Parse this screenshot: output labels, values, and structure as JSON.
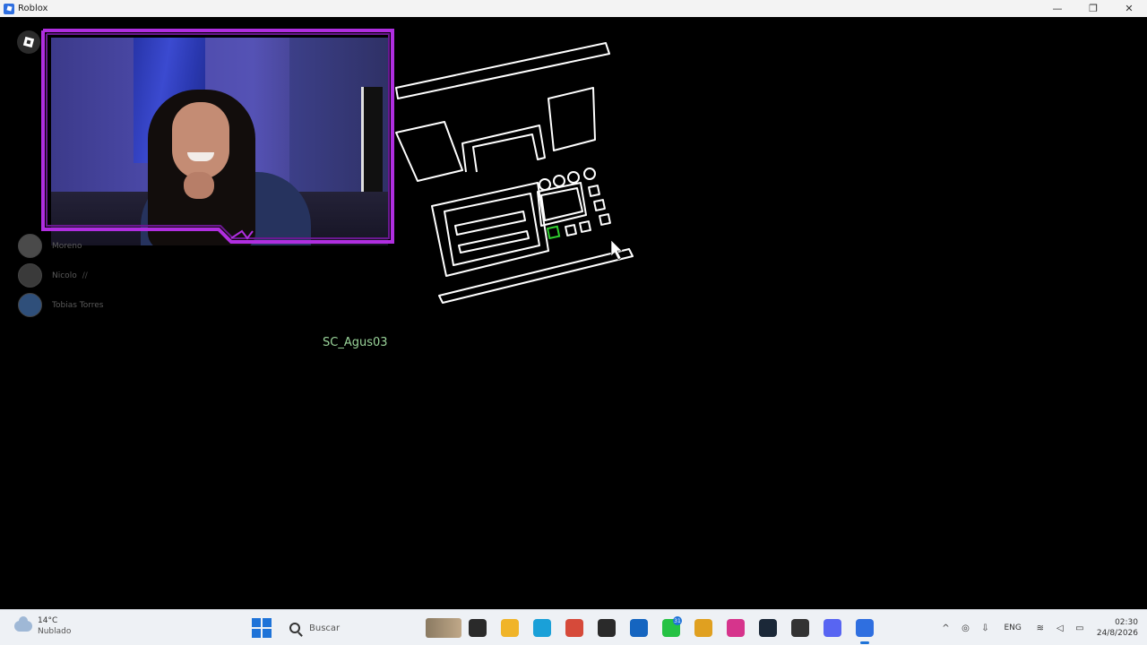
{
  "window": {
    "title": "Roblox",
    "minimize": "—",
    "maximize": "❐",
    "close": "✕"
  },
  "players": [
    {
      "name": "Moreno",
      "mark": ""
    },
    {
      "name": "Nicolo",
      "mark": "//"
    },
    {
      "name": "Tobias Torres",
      "mark": ""
    }
  ],
  "game": {
    "username_label": "SC_Agus03"
  },
  "colors": {
    "cam_border": "#b02ee0",
    "username": "#9ad49a",
    "highlight": "#2fcf2f"
  },
  "taskbar": {
    "weather_temp": "14°C",
    "weather_condition": "Nublado",
    "search_placeholder": "Buscar",
    "apps": [
      {
        "name": "task-view-icon",
        "color": "#2a2a2a",
        "badge": ""
      },
      {
        "name": "file-explorer-icon",
        "color": "#f0b429",
        "badge": ""
      },
      {
        "name": "edge-icon",
        "color": "#1aa0d8",
        "badge": ""
      },
      {
        "name": "chrome-profile-icon",
        "color": "#d64a3a",
        "badge": ""
      },
      {
        "name": "epic-games-icon",
        "color": "#2a2a2a",
        "badge": ""
      },
      {
        "name": "outlook-icon",
        "color": "#1565c0",
        "badge": ""
      },
      {
        "name": "whatsapp-icon",
        "color": "#25c244",
        "badge": "31"
      },
      {
        "name": "chrome-icon",
        "color": "#e0a020",
        "badge": ""
      },
      {
        "name": "instagram-icon",
        "color": "#d6348c",
        "badge": ""
      },
      {
        "name": "steam-icon",
        "color": "#1b2838",
        "badge": ""
      },
      {
        "name": "roblox-studio-icon",
        "color": "#333333",
        "badge": ""
      },
      {
        "name": "discord-icon",
        "color": "#5865f2",
        "badge": ""
      },
      {
        "name": "roblox-icon",
        "color": "#2f6fe0",
        "badge": ""
      }
    ],
    "tray_chevron": "^",
    "language": "ENG",
    "time": "02:30",
    "date": "24/8/2026"
  }
}
